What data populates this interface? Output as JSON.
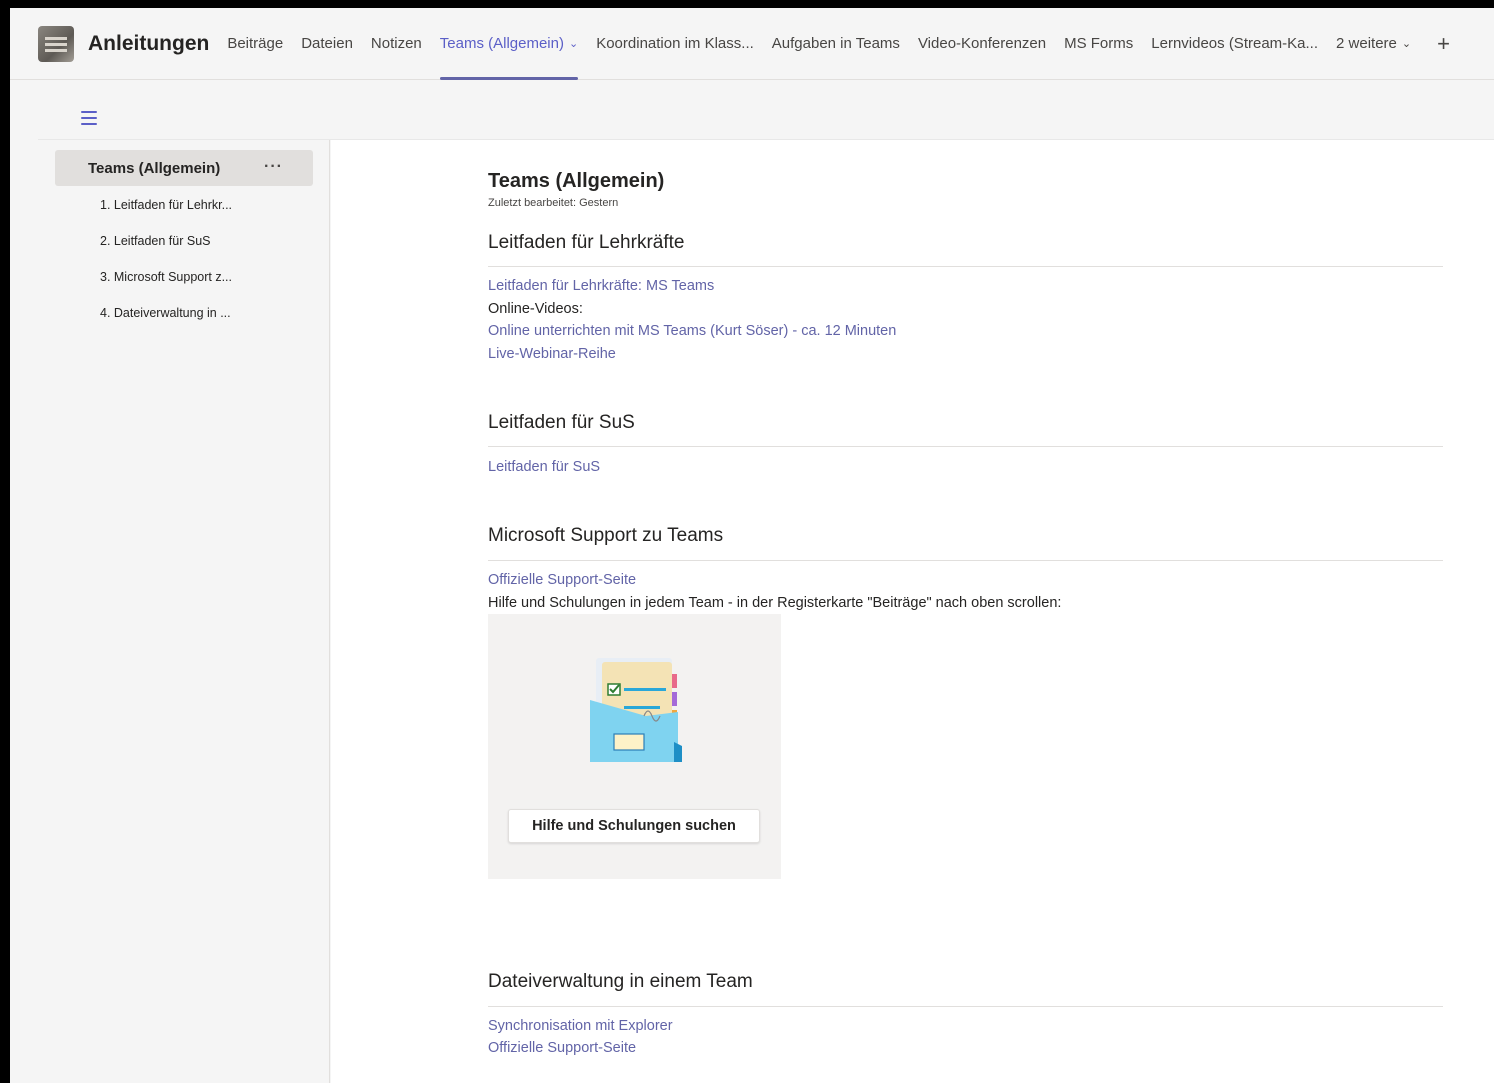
{
  "header": {
    "team_name": "Anleitungen",
    "tabs": [
      {
        "label": "Beiträge"
      },
      {
        "label": "Dateien"
      },
      {
        "label": "Notizen"
      },
      {
        "label": "Teams (Allgemein)",
        "active": true
      },
      {
        "label": "Koordination im Klass..."
      },
      {
        "label": "Aufgaben in Teams"
      },
      {
        "label": "Video-Konferenzen"
      },
      {
        "label": "MS Forms"
      },
      {
        "label": "Lernvideos (Stream-Ka..."
      },
      {
        "label": "2 weitere"
      }
    ],
    "add_tab": "+"
  },
  "sidebar": {
    "section_title": "Teams (Allgemein)",
    "more_label": "···",
    "pages": [
      "1. Leitfaden für Lehrkr...",
      "2. Leitfaden für SuS",
      "3. Microsoft Support z...",
      "4. Dateiverwaltung in ..."
    ]
  },
  "doc": {
    "title": "Teams (Allgemein)",
    "meta": "Zuletzt bearbeitet: Gestern",
    "sections": [
      {
        "heading": "Leitfaden für Lehrkräfte",
        "lines": [
          {
            "text": "Leitfaden für Lehrkräfte: MS Teams",
            "link": true
          },
          {
            "text": "Online-Videos:",
            "link": false
          },
          {
            "text": "Online unterrichten mit MS Teams (Kurt Söser) - ca. 12 Minuten",
            "link": true
          },
          {
            "text": "Live-Webinar-Reihe",
            "link": true
          }
        ]
      },
      {
        "heading": "Leitfaden für SuS",
        "lines": [
          {
            "text": "Leitfaden für SuS",
            "link": true
          }
        ]
      },
      {
        "heading": "Microsoft Support zu Teams",
        "lines": [
          {
            "text": "Offizielle Support-Seite",
            "link": true
          },
          {
            "text": "Hilfe und Schulungen in jedem Team - in der Registerkarte \"Beiträge\" nach oben scrollen:",
            "link": false
          }
        ],
        "help_button": "Hilfe und Schulungen suchen"
      },
      {
        "heading": "Dateiverwaltung in einem Team",
        "lines": [
          {
            "text": "Synchronisation mit Explorer",
            "link": true
          },
          {
            "text": "Offizielle Support-Seite",
            "link": true
          }
        ]
      }
    ]
  },
  "colors": {
    "accent": "#6264a7",
    "link": "#6264a7",
    "background": "#f5f5f5"
  }
}
